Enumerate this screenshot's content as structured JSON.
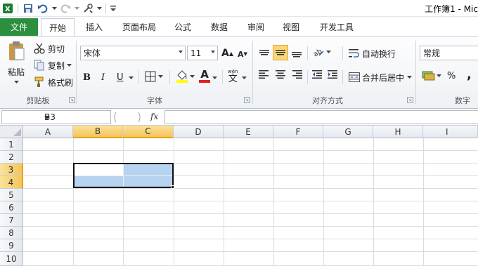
{
  "window": {
    "title": "工作簿1 - Mic"
  },
  "tabs": {
    "file": "文件",
    "items": [
      "开始",
      "插入",
      "页面布局",
      "公式",
      "数据",
      "审阅",
      "视图",
      "开发工具"
    ],
    "active_index": 0
  },
  "clipboard": {
    "paste": "粘贴",
    "cut": "剪切",
    "copy": "复制",
    "format_painter": "格式刷",
    "group_label": "剪贴板"
  },
  "font": {
    "name": "宋体",
    "size": "11",
    "bold": "B",
    "italic": "I",
    "underline": "U",
    "color_letter": "A",
    "grow": "A",
    "shrink": "A",
    "group_label": "字体",
    "wen": "wén"
  },
  "alignment": {
    "wrap_text": "自动换行",
    "merge_center": "合并后居中",
    "group_label": "对齐方式"
  },
  "number": {
    "format": "常规",
    "percent": "%",
    "comma": ",",
    "group_label": "数字"
  },
  "formula_bar": {
    "name_box": "B3",
    "fx": "fx",
    "content": ""
  },
  "sheet": {
    "columns": [
      "A",
      "B",
      "C",
      "D",
      "E",
      "F",
      "G",
      "H",
      "I"
    ],
    "rows": [
      "1",
      "2",
      "3",
      "4",
      "5",
      "6",
      "7",
      "8",
      "9",
      "10"
    ],
    "selected_columns": [
      "B",
      "C"
    ],
    "selected_rows": [
      "3",
      "4"
    ],
    "active_cell": "B3",
    "selection": "B3:C4"
  },
  "colors": {
    "file_tab": "#2c8f3d",
    "selection_fill": "#b6d3ef",
    "header_selected": "#f5c45b",
    "highlight_yellow": "#ffff00",
    "font_red": "#e02020"
  }
}
